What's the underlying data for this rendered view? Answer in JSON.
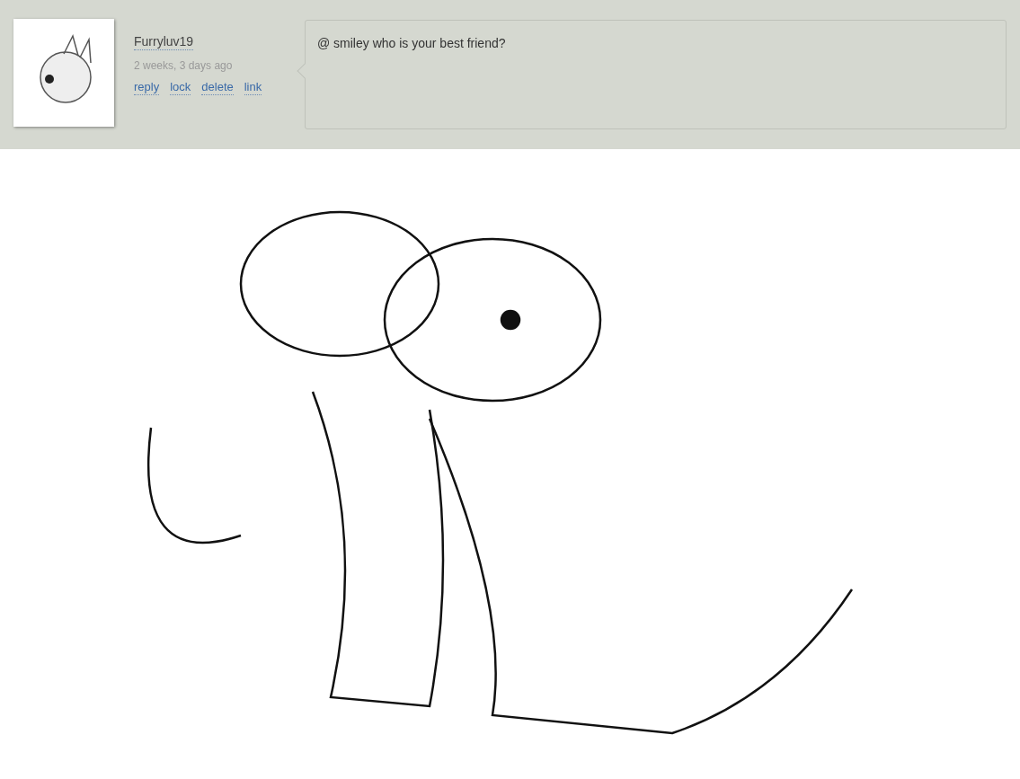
{
  "comment": {
    "author": "Furryluv19",
    "time": "2 weeks, 3 days ago",
    "actions": [
      "reply",
      "lock",
      "delete",
      "link"
    ],
    "message": "@ smiley who is your best friend?"
  }
}
